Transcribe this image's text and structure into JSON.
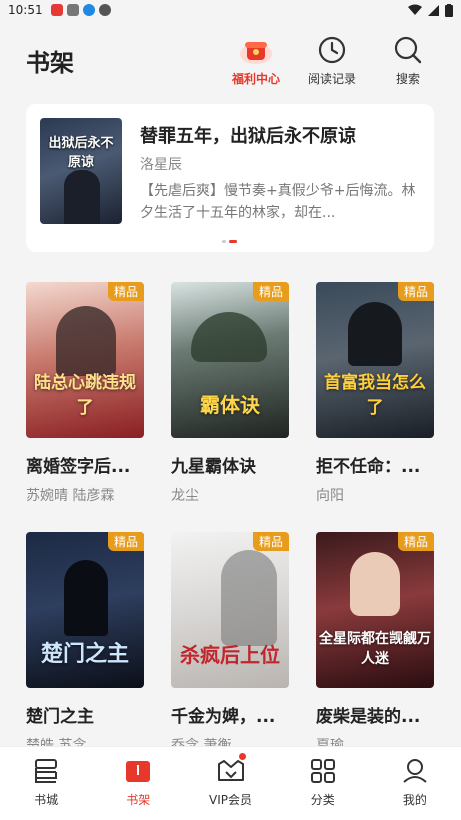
{
  "status": {
    "time": "10:51"
  },
  "header": {
    "title": "书架",
    "actions": [
      {
        "label": "福利中心",
        "icon": "gift-icon"
      },
      {
        "label": "阅读记录",
        "icon": "clock-icon"
      },
      {
        "label": "搜索",
        "icon": "search-icon"
      }
    ]
  },
  "recommend": {
    "title": "替罪五年，出狱后永不原谅",
    "author": "洛星辰",
    "desc": "【先虐后爽】慢节奏+真假少爷+后悔流。林夕生活了十五年的林家，却在...",
    "cover_text": "出狱后永不原谅"
  },
  "books": [
    {
      "title": "离婚签字后...",
      "author": "苏婉晴  陆彦霖",
      "badge": "精品",
      "cover_text": "陆总心跳违规了"
    },
    {
      "title": "九星霸体诀",
      "author": "龙尘",
      "badge": "精品",
      "cover_text": "霸体诀"
    },
    {
      "title": "拒不任命：...",
      "author": "向阳",
      "badge": "精品",
      "cover_text": "首富我当怎么了"
    },
    {
      "title": "楚门之主",
      "author": "楚皓  苏念",
      "badge": "精品",
      "cover_text": "楚门之主"
    },
    {
      "title": "千金为婢，...",
      "author": "乔念  萧衡",
      "badge": "精品",
      "cover_text": "杀疯后上位"
    },
    {
      "title": "废柴是装的...",
      "author": "夏瑜",
      "badge": "精品",
      "cover_text": "全星际都在觊觎万人迷"
    }
  ],
  "nav": [
    {
      "label": "书城",
      "icon": "bookstore-icon"
    },
    {
      "label": "书架",
      "icon": "bookshelf-icon"
    },
    {
      "label": "VIP会员",
      "icon": "vip-crown-icon"
    },
    {
      "label": "分类",
      "icon": "category-grid-icon"
    },
    {
      "label": "我的",
      "icon": "profile-icon"
    }
  ],
  "colors": {
    "accent": "#e8382b",
    "badge": "#e89c1c"
  }
}
